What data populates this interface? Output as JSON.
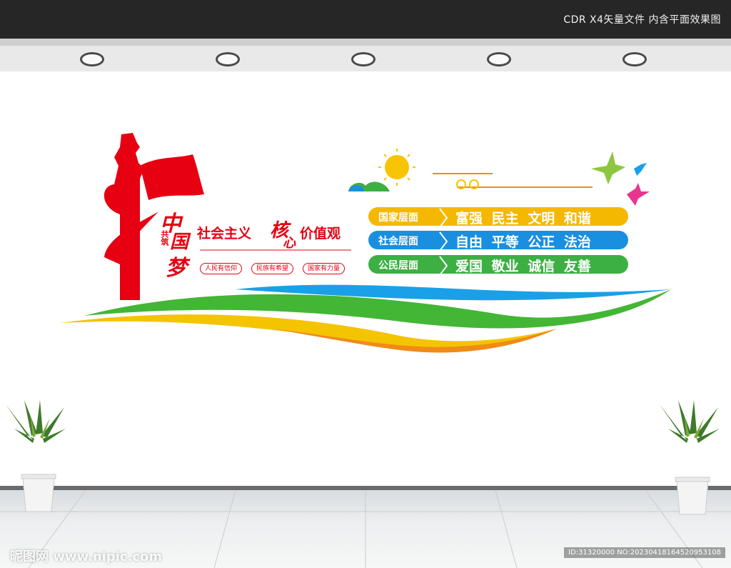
{
  "header": {
    "text": "CDR X4矢量文件  内含平面效果图"
  },
  "mural": {
    "gongzhu": "共筑",
    "zhongguomeng": [
      "中",
      "国",
      "梦"
    ],
    "slogan_main": "社会主义",
    "slogan_core": "核",
    "slogan_core2": "心",
    "slogan_value": "价值观",
    "tags": [
      "人民有信仰",
      "民族有希望",
      "国家有力量"
    ],
    "rows": [
      {
        "level": "国家层面",
        "values": "富强 民主 文明 和谐",
        "color": "#f5b800"
      },
      {
        "level": "社会层面",
        "values": "自由 平等 公正 法治",
        "color": "#1a8fe0"
      },
      {
        "level": "公民层面",
        "values": "爱国 敬业 诚信 友善",
        "color": "#3cb043"
      }
    ]
  },
  "watermark": {
    "left": "昵图网 www.nipic.com",
    "right": "ID:31320000 NO:20230418164520953108"
  }
}
